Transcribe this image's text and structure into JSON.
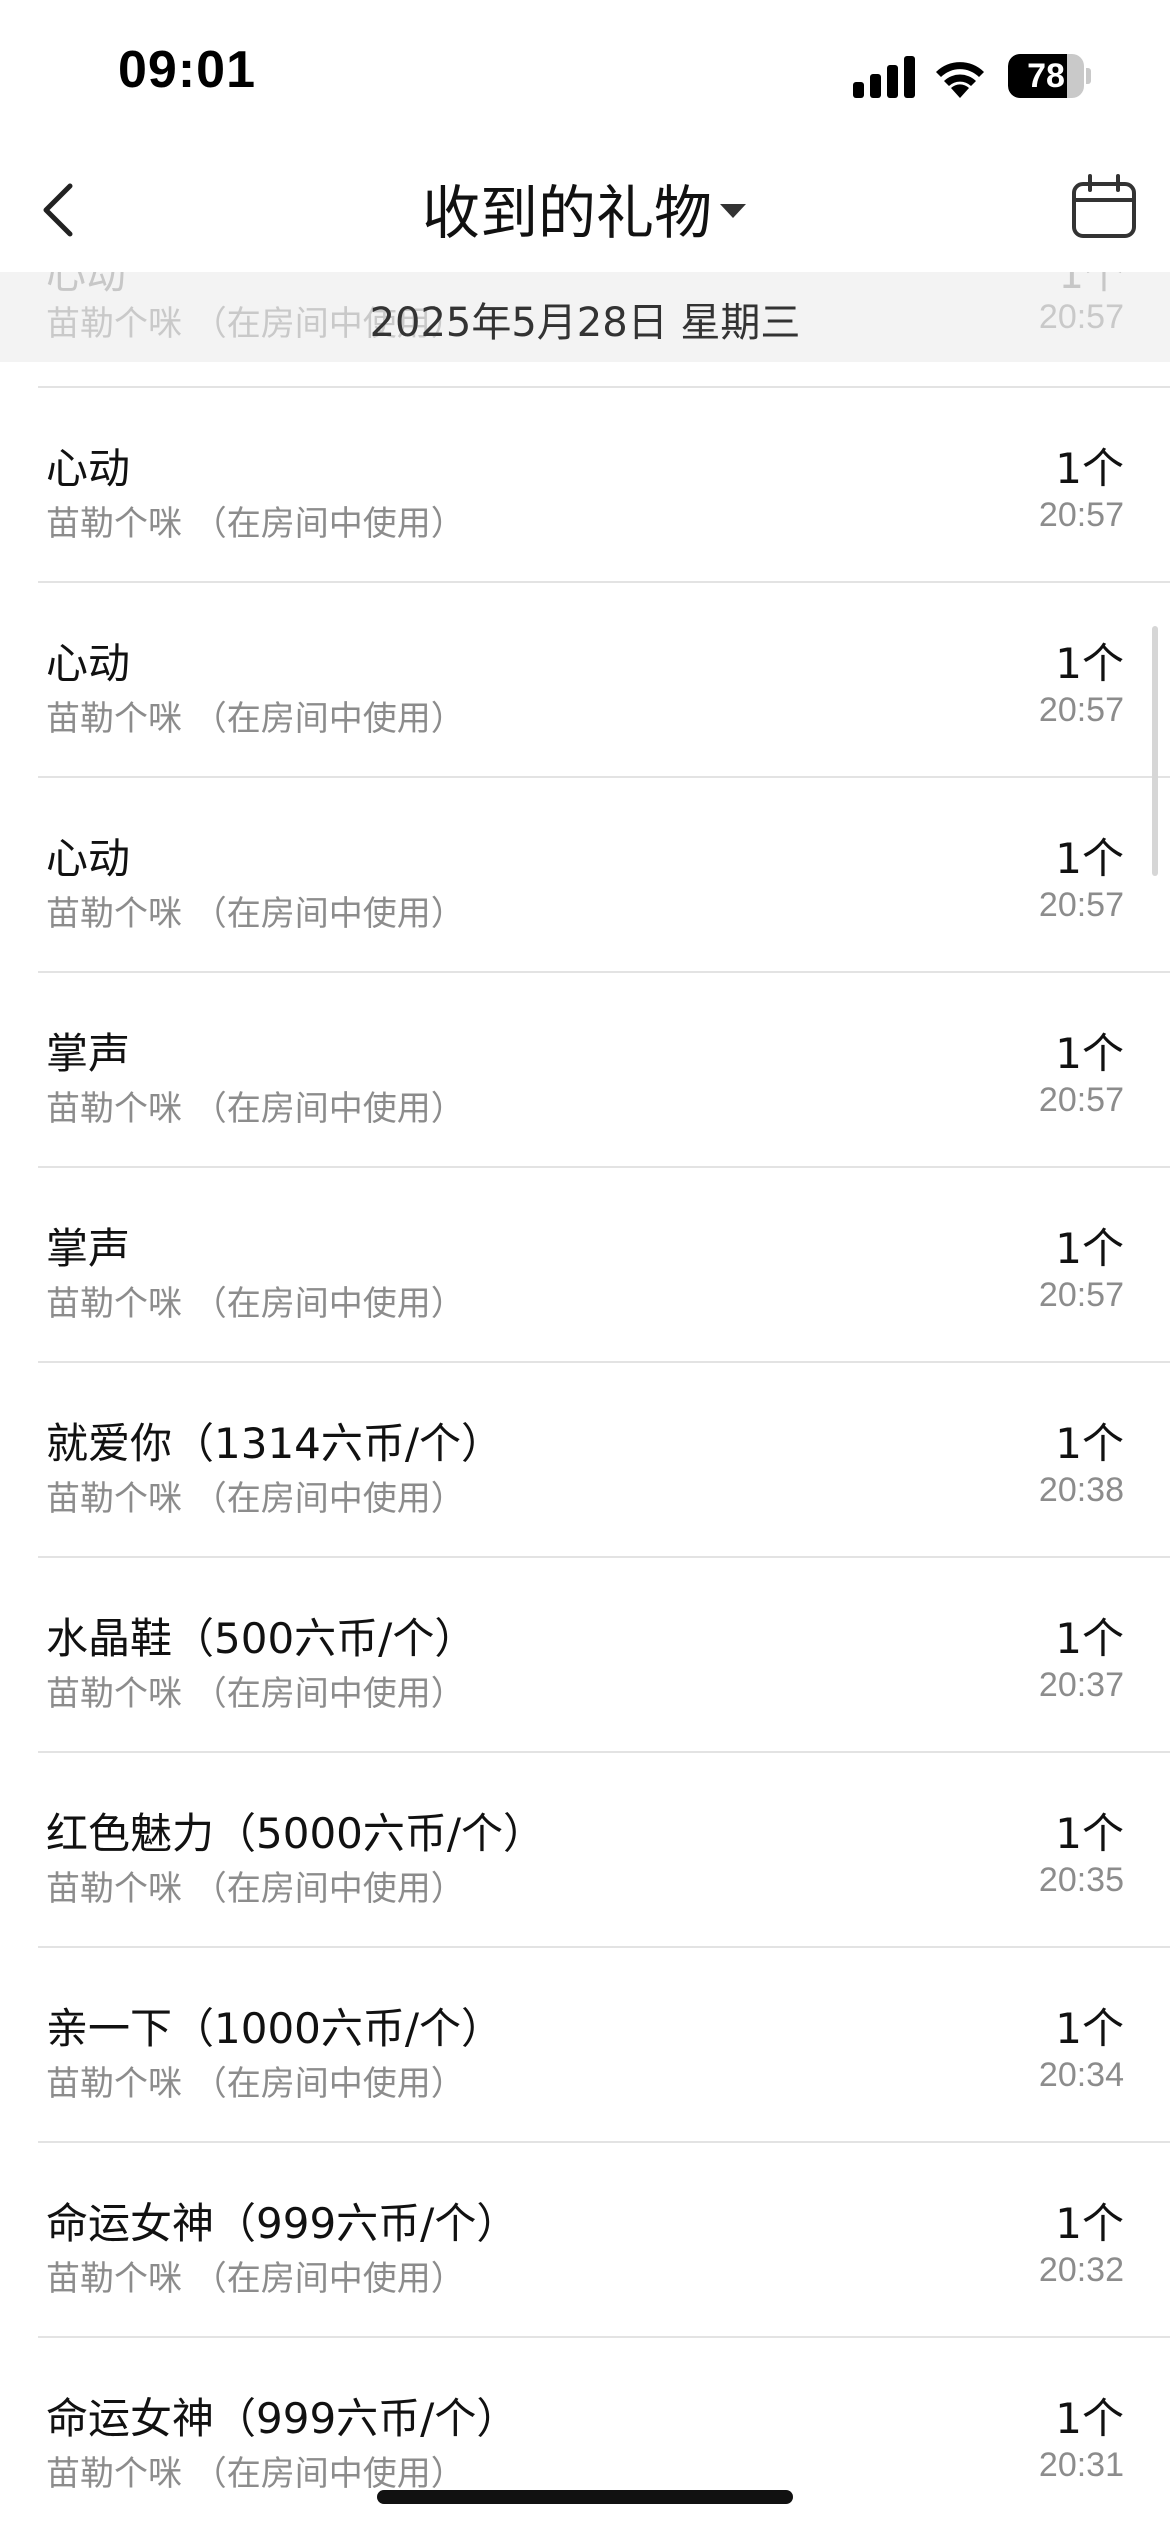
{
  "status_bar": {
    "time": "09:01",
    "battery_percent": 78,
    "battery_text": "78",
    "icons": [
      "cellular-signal-icon",
      "wifi-icon",
      "battery-icon"
    ]
  },
  "nav": {
    "title": "收到的礼物",
    "back_icon": "chevron-left-icon",
    "dropdown_icon": "caret-down-icon",
    "calendar_icon": "calendar-icon"
  },
  "date_header": {
    "label": "2025年5月28日 星期三",
    "partial_row": {
      "name": "心动",
      "source": "苗勒个咪 （在房间中使用）",
      "quantity": "1个",
      "time": "20:57"
    }
  },
  "gifts": [
    {
      "name": "心动",
      "source": "苗勒个咪 （在房间中使用）",
      "quantity": "1个",
      "time": "20:57"
    },
    {
      "name": "心动",
      "source": "苗勒个咪 （在房间中使用）",
      "quantity": "1个",
      "time": "20:57"
    },
    {
      "name": "心动",
      "source": "苗勒个咪 （在房间中使用）",
      "quantity": "1个",
      "time": "20:57"
    },
    {
      "name": "掌声",
      "source": "苗勒个咪 （在房间中使用）",
      "quantity": "1个",
      "time": "20:57"
    },
    {
      "name": "掌声",
      "source": "苗勒个咪 （在房间中使用）",
      "quantity": "1个",
      "time": "20:57"
    },
    {
      "name": "就爱你（1314六币/个）",
      "source": "苗勒个咪 （在房间中使用）",
      "quantity": "1个",
      "time": "20:38"
    },
    {
      "name": "水晶鞋（500六币/个）",
      "source": "苗勒个咪 （在房间中使用）",
      "quantity": "1个",
      "time": "20:37"
    },
    {
      "name": "红色魅力（5000六币/个）",
      "source": "苗勒个咪 （在房间中使用）",
      "quantity": "1个",
      "time": "20:35"
    },
    {
      "name": "亲一下（1000六币/个）",
      "source": "苗勒个咪 （在房间中使用）",
      "quantity": "1个",
      "time": "20:34"
    },
    {
      "name": "命运女神（999六币/个）",
      "source": "苗勒个咪 （在房间中使用）",
      "quantity": "1个",
      "time": "20:32"
    },
    {
      "name": "命运女神（999六币/个）",
      "source": "苗勒个咪 （在房间中使用）",
      "quantity": "1个",
      "time": "20:31"
    }
  ]
}
